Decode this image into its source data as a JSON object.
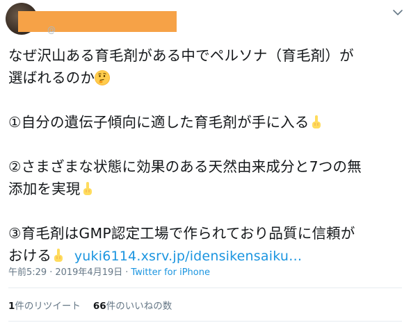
{
  "header": {
    "author_name_redacted": true,
    "handle_stub": "@",
    "menu_icon": "chevron-down-icon"
  },
  "tweet": {
    "lines": [
      {
        "text": "なぜ沢山ある育毛剤がある中でペルソナ（育毛剤）が"
      },
      {
        "text": "選ばれるのか",
        "emoji": "thinking-face-emoji"
      },
      {
        "text": "①自分の遺伝子傾向に適した育毛剤が手に入る",
        "emoji": "pointing-up-emoji"
      },
      {
        "text": "②さまざまな状態に効果のある天然由来成分と7つの無"
      },
      {
        "text": "添加を実現",
        "emoji": "pointing-up-emoji"
      },
      {
        "text": "③育毛剤はGMP認定工場で作られており品質に信頼が"
      },
      {
        "text": "おける",
        "emoji": "pointing-up-emoji",
        "link": "yuki6114.xsrv.jp/idensikensaiku…"
      }
    ]
  },
  "meta": {
    "time": "午前5:29",
    "separator": "·",
    "date": "2019年4月19日",
    "source": "Twitter for iPhone"
  },
  "stats": {
    "retweets_count": "1",
    "retweets_label": "件のリツイート",
    "likes_count": "66",
    "likes_label": "件のいいねの数"
  },
  "colors": {
    "text": "#14171a",
    "muted": "#657786",
    "link": "#1b95e0",
    "divider": "#e6ecf0",
    "redaction": "#f6a247"
  }
}
